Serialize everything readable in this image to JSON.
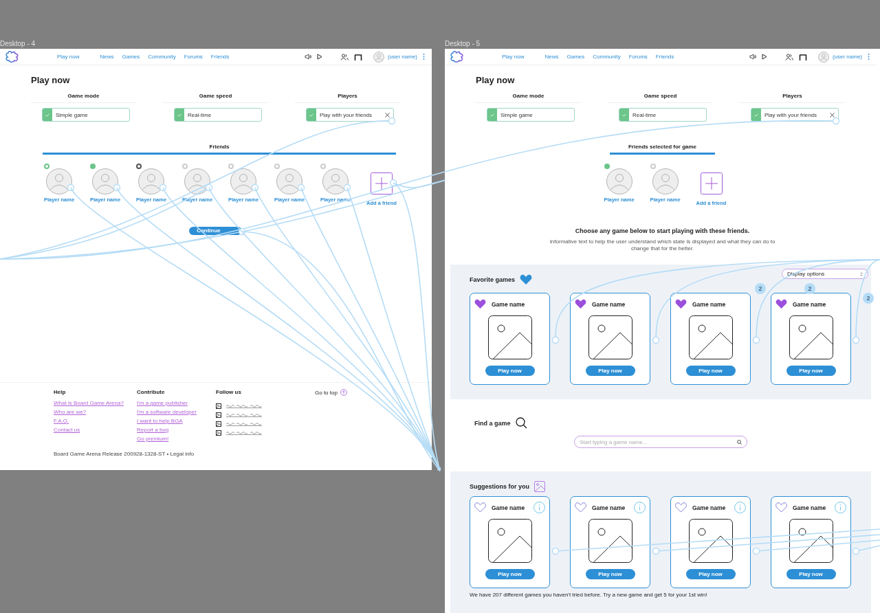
{
  "frames": [
    {
      "kind": "setup",
      "label": "Desktop - 4",
      "nav": [
        "Play now",
        "News",
        "Games",
        "Community",
        "Forums",
        "Friends"
      ],
      "user_name": "(user name)",
      "title": "Play now",
      "options": [
        {
          "heading": "Game mode",
          "value": "Simple game",
          "checked": true,
          "clearable": false
        },
        {
          "heading": "Game speed",
          "value": "Real-time",
          "checked": true,
          "clearable": false
        },
        {
          "heading": "Players",
          "value": "Play with your friends",
          "checked": true,
          "clearable": true
        }
      ],
      "friends": {
        "heading": "Friends",
        "add_label": "Add a friend",
        "players": [
          {
            "name": "Player name",
            "color": "#6cc58a",
            "filled": false
          },
          {
            "name": "Player name",
            "color": "#6cc58a",
            "filled": true
          },
          {
            "name": "Player name",
            "color": "#555555",
            "filled": false
          },
          {
            "name": "Player name",
            "color": "#cccccc",
            "filled": false
          },
          {
            "name": "Player name",
            "color": "#cccccc",
            "filled": false
          },
          {
            "name": "Player name",
            "color": "#cccccc",
            "filled": false
          },
          {
            "name": "Player name",
            "color": "#cccccc",
            "filled": false
          }
        ]
      },
      "continue_label": "Continue",
      "footer": {
        "columns": [
          {
            "heading": "Help",
            "links": [
              "What is Board Game Arena?",
              "Who are we?",
              "F.A.Q.",
              "Contact us"
            ]
          },
          {
            "heading": "Contribute",
            "links": [
              "I'm a game publisher",
              "I'm a software developer",
              "I want to help BGA",
              "Report a bug",
              "Go premium!"
            ]
          }
        ],
        "follow_heading": "Follow us",
        "go_top": "Go to top",
        "release": "Board Game Arena Release 200928-1328-ST • Legal info"
      }
    },
    {
      "kind": "results",
      "label": "Desktop - 5",
      "nav": [
        "Play now",
        "News",
        "Games",
        "Community",
        "Forums",
        "Friends"
      ],
      "user_name": "(user name)",
      "title": "Play now",
      "options": [
        {
          "heading": "Game mode",
          "value": "Simple game",
          "checked": true,
          "clearable": false
        },
        {
          "heading": "Game speed",
          "value": "Real-time",
          "checked": true,
          "clearable": false
        },
        {
          "heading": "Players",
          "value": "Play with your friends",
          "checked": true,
          "clearable": true
        }
      ],
      "friends": {
        "heading": "Friends selected for game",
        "add_label": "Add a friend",
        "players": [
          {
            "name": "Player name",
            "color": "#6cc58a",
            "filled": true
          },
          {
            "name": "Player name",
            "color": "#cccccc",
            "filled": false
          }
        ]
      },
      "message": {
        "heading": "Choose any game below to start playing with these friends.",
        "body": "Informative text to help the user understand which state is displayed and what they can do to change that for the better."
      },
      "favorites": {
        "title": "Favorite games",
        "display_options": "Display options",
        "cards": [
          {
            "name": "Game name",
            "favorite": true,
            "info": false,
            "button": "Play now"
          },
          {
            "name": "Game name",
            "favorite": true,
            "info": false,
            "button": "Play now"
          },
          {
            "name": "Game name",
            "favorite": true,
            "info": false,
            "button": "Play now"
          },
          {
            "name": "Game name",
            "favorite": true,
            "info": false,
            "button": "Play now"
          }
        ]
      },
      "connection_badges": [
        "2",
        "2",
        "2"
      ],
      "find": {
        "title": "Find a game",
        "placeholder": "Start typing a game name..."
      },
      "suggestions": {
        "title": "Suggestions for you",
        "cards": [
          {
            "name": "Game name",
            "favorite": false,
            "info": true,
            "button": "Play now"
          },
          {
            "name": "Game name",
            "favorite": false,
            "info": true,
            "button": "Play now"
          },
          {
            "name": "Game name",
            "favorite": false,
            "info": true,
            "button": "Play now"
          },
          {
            "name": "Game name",
            "favorite": false,
            "info": true,
            "button": "Play now"
          }
        ],
        "note": "We have 207 different games you haven't tried before. Try a new game and get 5 for your 1st win!"
      }
    }
  ]
}
